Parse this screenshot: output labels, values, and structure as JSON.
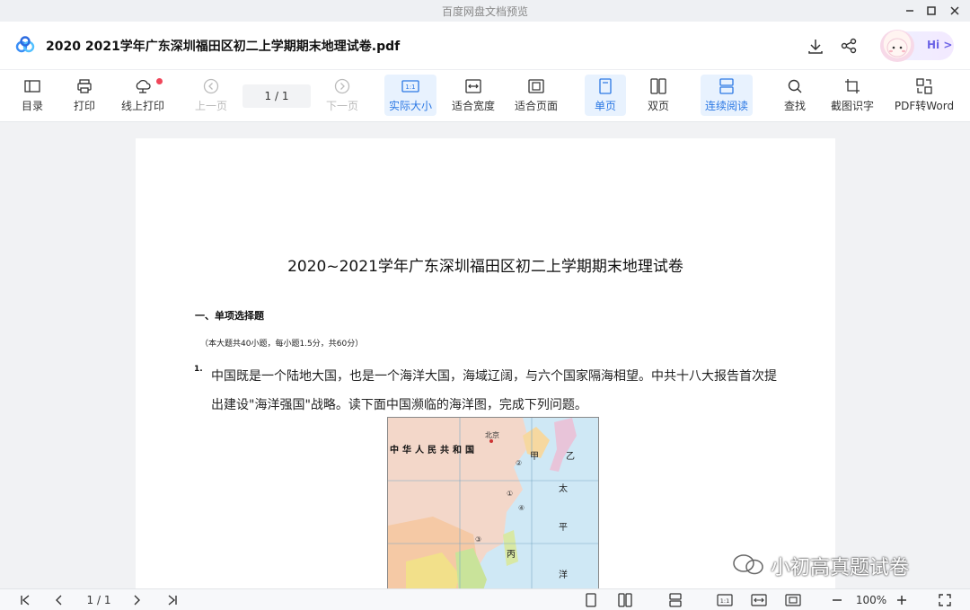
{
  "window": {
    "title": "百度网盘文档预览"
  },
  "header": {
    "doc_title": "2020 2021学年广东深圳福田区初二上学期期末地理试卷.pdf",
    "hi_label": "Hi >"
  },
  "toolbar": {
    "toc": "目录",
    "print": "打印",
    "online_print": "线上打印",
    "prev": "上一页",
    "page_indicator": "1 / 1",
    "next": "下一页",
    "actual_size": "实际大小",
    "fit_width": "适合宽度",
    "fit_page": "适合页面",
    "single_page": "单页",
    "double_page": "双页",
    "continuous": "连续阅读",
    "find": "查找",
    "ocr": "截图识字",
    "pdf_to_word": "PDF转Word"
  },
  "document": {
    "title": "2020~2021学年广东深圳福田区初二上学期期末地理试卷",
    "section": "一、单项选择题",
    "section_note": "（本大题共40小题，每小题1.5分，共60分）",
    "q_number": "1.",
    "q_line1": "中国既是一个陆地大国，也是一个海洋大国，海域辽阔，与六个国家隔海相望。中共十八大报告首次提",
    "q_line2": "出建设\"海洋强国\"战略。读下面中国濒临的海洋图，完成下列问题。",
    "map": {
      "country_label": "中华人民共和国",
      "capital": "北京",
      "labels": [
        "甲",
        "乙",
        "太",
        "平",
        "洋",
        "丙",
        "②",
        "①",
        "④",
        "③"
      ]
    },
    "watermark": "小初高真题试卷"
  },
  "bottombar": {
    "page_indicator": "1 / 1",
    "zoom": "100%"
  },
  "colors": {
    "accent": "#2b78e4",
    "active_bg": "#e8f2fe",
    "badge": "#f0465a"
  }
}
